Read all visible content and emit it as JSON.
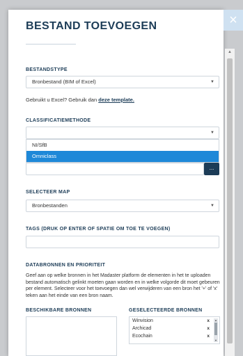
{
  "modal": {
    "title": "BESTAND TOEVOEGEN",
    "close_icon": "close-icon"
  },
  "bestandstype": {
    "label": "BESTANDSTYPE",
    "value": "Bronbestand (BIM of Excel)",
    "help_prefix": "Gebruikt u Excel? Gebruik dan ",
    "help_link": "deze template."
  },
  "classificatie": {
    "label": "CLASSIFICATIEMETHODE",
    "value": "",
    "options": [
      "NI/SfB",
      "Omniclass"
    ],
    "selected_index": 1,
    "browse_label": "..."
  },
  "map": {
    "label": "SELECTEER MAP",
    "value": "Bronbestanden"
  },
  "tags": {
    "label": "TAGS (DRUK OP ENTER OF SPATIE OM TOE TE VOEGEN)",
    "value": ""
  },
  "databronnen": {
    "label": "DATABRONNEN EN PRIORITEIT",
    "description": "Geef aan op welke bronnen in het Madaster platform de elementen in het te uploaden bestand automatisch gelinkt moeten gaan worden en in welke volgorde dit moet gebeuren per element. Selecteer voor het toevoegen dan wel verwijderen van een bron het '+' of 'x' teken aan het einde van een bron naam.",
    "available_label": "BESCHIKBARE BRONNEN",
    "selected_label": "GESELECTEERDE BRONNEN",
    "selected_sources": [
      {
        "name": "Winvision",
        "action": "x"
      },
      {
        "name": "Archicad",
        "action": "x"
      },
      {
        "name": "Ecochain",
        "action": "x"
      }
    ]
  },
  "colors": {
    "title": "#1c3c57",
    "accent": "#1e88d8",
    "close_bg": "#cfe1f1"
  }
}
